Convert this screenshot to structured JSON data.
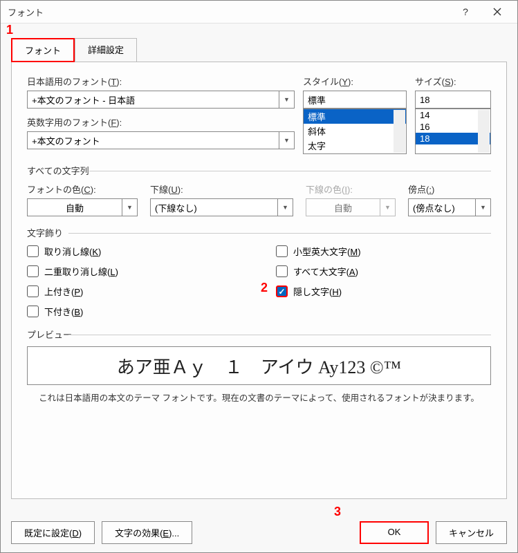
{
  "window": {
    "title": "フォント"
  },
  "tabs": {
    "font": "フォント",
    "advanced": "詳細設定"
  },
  "markers": {
    "m1": "1",
    "m2": "2",
    "m3": "3"
  },
  "jpfont": {
    "label_pre": "日本語用のフォント(",
    "label_u": "T",
    "label_post": "):",
    "value": "+本文のフォント - 日本語"
  },
  "enfont": {
    "label_pre": "英数字用のフォント(",
    "label_u": "F",
    "label_post": "):",
    "value": "+本文のフォント"
  },
  "style": {
    "label_pre": "スタイル(",
    "label_u": "Y",
    "label_post": "):",
    "value": "標準",
    "opts": [
      "標準",
      "斜体",
      "太字"
    ]
  },
  "size": {
    "label_pre": "サイズ(",
    "label_u": "S",
    "label_post": "):",
    "value": "18",
    "opts": [
      "14",
      "16",
      "18"
    ]
  },
  "allchars": {
    "label": "すべての文字列"
  },
  "fontcolor": {
    "label_pre": "フォントの色(",
    "label_u": "C",
    "label_post": "):",
    "value": "自動"
  },
  "underline": {
    "label_pre": "下線(",
    "label_u": "U",
    "label_post": "):",
    "value": "(下線なし)"
  },
  "ulcolor": {
    "label_pre": "下線の色(",
    "label_u": "I",
    "label_post": "):",
    "value": "自動"
  },
  "emphasis": {
    "label_pre": "傍点(",
    "label_u": ":",
    "label_post": ")",
    "value": "(傍点なし)"
  },
  "effects": {
    "label": "文字飾り",
    "strike_pre": "取り消し線(",
    "strike_u": "K",
    "strike_post": ")",
    "dstrike_pre": "二重取り消し線(",
    "dstrike_u": "L",
    "dstrike_post": ")",
    "super_pre": "上付き(",
    "super_u": "P",
    "super_post": ")",
    "sub_pre": "下付き(",
    "sub_u": "B",
    "sub_post": ")",
    "smallcaps_pre": "小型英大文字(",
    "smallcaps_u": "M",
    "smallcaps_post": ")",
    "allcaps_pre": "すべて大文字(",
    "allcaps_u": "A",
    "allcaps_post": ")",
    "hidden_pre": "隠し文字(",
    "hidden_u": "H",
    "hidden_post": ")"
  },
  "preview": {
    "label": "プレビュー",
    "text": "あア亜Ａｙ　１　アイウ Ay123 ©™",
    "desc": "これは日本語用の本文のテーマ フォントです。現在の文書のテーマによって、使用されるフォントが決まります。"
  },
  "buttons": {
    "default_pre": "既定に設定(",
    "default_u": "D",
    "default_post": ")",
    "texteffects_pre": "文字の効果(",
    "texteffects_u": "E",
    "texteffects_post": ")...",
    "ok": "OK",
    "cancel": "キャンセル"
  }
}
